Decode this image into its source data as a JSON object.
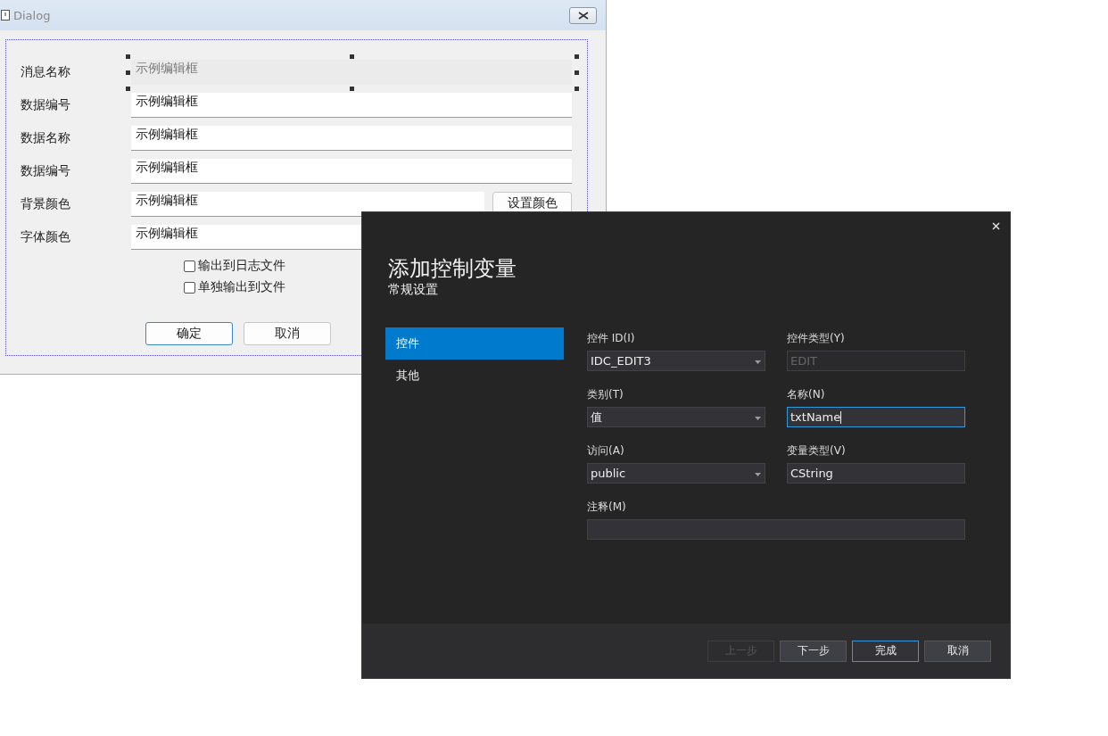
{
  "mfc_dialog": {
    "title": "Dialog",
    "rows": [
      {
        "label": "消息名称",
        "value": "示例编辑框",
        "selected": true
      },
      {
        "label": "数据编号",
        "value": "示例编辑框",
        "selected": false
      },
      {
        "label": "数据名称",
        "value": "示例编辑框",
        "selected": false
      },
      {
        "label": "数据编号",
        "value": "示例编辑框",
        "selected": false
      },
      {
        "label": "背景颜色",
        "value": "示例编辑框",
        "selected": false,
        "button": "设置颜色"
      },
      {
        "label": "字体颜色",
        "value": "示例编辑框",
        "selected": false
      }
    ],
    "checkboxes": [
      {
        "label": "输出到日志文件",
        "checked": false
      },
      {
        "label": "单独输出到文件",
        "checked": false
      }
    ],
    "buttons": [
      {
        "label": "确定",
        "default": true
      },
      {
        "label": "取消",
        "default": false
      }
    ]
  },
  "wizard": {
    "title": "添加控制变量",
    "subtitle": "常规设置",
    "nav": [
      {
        "label": "控件",
        "selected": true
      },
      {
        "label": "其他",
        "selected": false
      }
    ],
    "fields": [
      {
        "label": "控件 ID(I)",
        "value": "IDC_EDIT3",
        "kind": "dropdown",
        "disabled": false,
        "focused": false,
        "wide": false
      },
      {
        "label": "控件类型(Y)",
        "value": "EDIT",
        "kind": "text",
        "disabled": true,
        "focused": false,
        "wide": false
      },
      {
        "label": "类别(T)",
        "value": "值",
        "kind": "dropdown",
        "disabled": false,
        "focused": false,
        "wide": false
      },
      {
        "label": "名称(N)",
        "value": "txtName",
        "kind": "text",
        "disabled": false,
        "focused": true,
        "wide": false
      },
      {
        "label": "访问(A)",
        "value": "public",
        "kind": "dropdown",
        "disabled": false,
        "focused": false,
        "wide": false
      },
      {
        "label": "变量类型(V)",
        "value": "CString",
        "kind": "text",
        "disabled": false,
        "focused": false,
        "wide": false
      },
      {
        "label": "注释(M)",
        "kind": "text",
        "disabled": false,
        "focused": false,
        "wide": true
      }
    ],
    "buttons": [
      {
        "label": "上一步",
        "disabled": true,
        "focused": false
      },
      {
        "label": "下一步",
        "disabled": false,
        "focused": false
      },
      {
        "label": "完成",
        "disabled": false,
        "focused": true
      },
      {
        "label": "取消",
        "disabled": false,
        "focused": false
      }
    ]
  }
}
